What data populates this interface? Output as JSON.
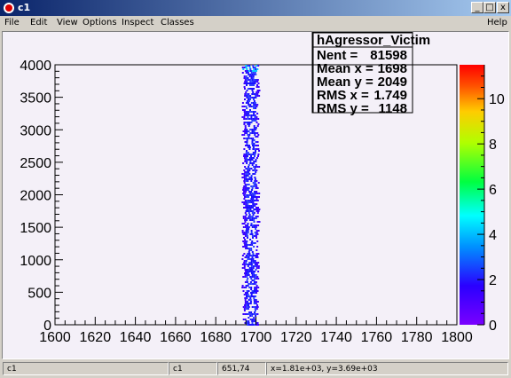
{
  "window": {
    "title": "c1",
    "buttons": [
      "_",
      "□",
      "x"
    ]
  },
  "menu": {
    "file": "File",
    "edit": "Edit",
    "view": "View",
    "options": "Options",
    "inspect": "Inspect",
    "classes": "Classes",
    "help": "Help"
  },
  "stats": {
    "name": "hAgressor_Victim",
    "lines": [
      [
        "Nent = ",
        "81598"
      ],
      [
        "Mean x = ",
        "1698"
      ],
      [
        "Mean y = ",
        "2049"
      ],
      [
        "RMS x = ",
        "1.749"
      ],
      [
        "RMS y = ",
        "1148"
      ]
    ]
  },
  "chart_data": {
    "type": "heatmap",
    "xlim": [
      1600,
      1800
    ],
    "ylim": [
      0,
      4000
    ],
    "xticks": [
      "1600",
      "1620",
      "1640",
      "1660",
      "1680",
      "1700",
      "1720",
      "1740",
      "1760",
      "1780",
      "1800"
    ],
    "yticks": [
      "0",
      "500",
      "1000",
      "1500",
      "2000",
      "2500",
      "3000",
      "3500",
      "4000"
    ],
    "zticks": [
      "0",
      "2",
      "4",
      "6",
      "8",
      "10"
    ],
    "zlim": [
      0,
      11.5
    ],
    "band": {
      "x_center": 1698,
      "x_rms": 1.749,
      "y_min": 0,
      "y_max": 4000
    },
    "colors": {
      "frame_bg": "#f4f0f8",
      "low": "#1a00ff",
      "high": "#00ffff"
    }
  },
  "status": {
    "cell1": "c1",
    "cell2": "c1",
    "cell3": "651,74",
    "cell4": "x=1.81e+03, y=3.69e+03"
  }
}
